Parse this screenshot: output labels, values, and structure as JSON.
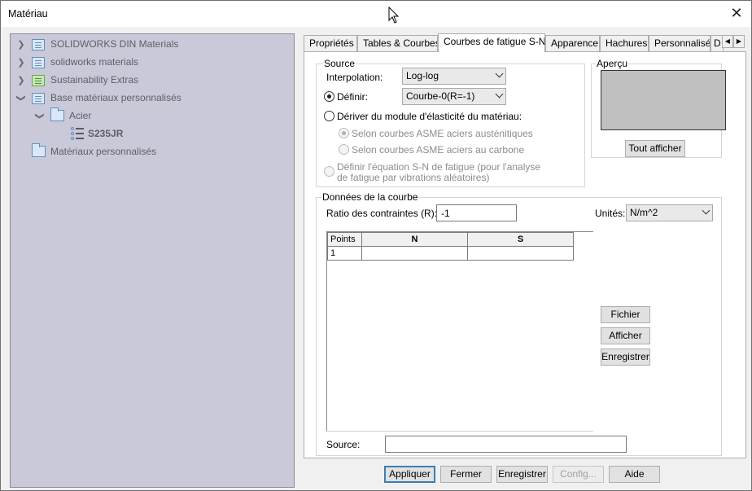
{
  "window": {
    "title": "Matériau",
    "close_glyph": "✕"
  },
  "tree": {
    "items": [
      {
        "label": "SOLIDWORKS DIN Materials",
        "icon": "database-icon"
      },
      {
        "label": "solidworks materials",
        "icon": "database-icon"
      },
      {
        "label": "Sustainability Extras",
        "icon": "database-green-icon"
      },
      {
        "label": "Base matériaux personnalisés",
        "icon": "database-icon"
      },
      {
        "label": "Acier",
        "icon": "folder-icon"
      },
      {
        "label": "S235JR",
        "icon": "material-icon"
      },
      {
        "label": "Matériaux personnalisés",
        "icon": "folder-icon"
      }
    ]
  },
  "tabs": [
    "Propriétés",
    "Tables & Courbes",
    "Courbes de fatigue S-N",
    "Apparence",
    "Hachures",
    "Personnalisé",
    "D"
  ],
  "source": {
    "legend": "Source",
    "interpolation_label": "Interpolation:",
    "interpolation_value": "Log-log",
    "definir_label": "Définir:",
    "definir_value": "Courbe-0(R=-1)",
    "deriver_label": "Dériver du module d'élasticité du matériau:",
    "asme_aust": "Selon courbes ASME aciers austénitiques",
    "asme_carb": "Selon courbes ASME aciers au carbone",
    "equation_line1": "Définir l'équation S-N de fatigue (pour l'analyse",
    "equation_line2": "de fatigue par vibrations aléatoires)"
  },
  "apercu": {
    "legend": "Aperçu",
    "button": "Tout afficher"
  },
  "curve": {
    "legend": "Données de la courbe",
    "ratio_label": "Ratio des contraintes (R):",
    "ratio_value": "-1",
    "units_label": "Unités:",
    "units_value": "N/m^2",
    "columns": [
      "Points",
      "N",
      "S"
    ],
    "rows": [
      [
        "1",
        "",
        ""
      ]
    ],
    "buttons": {
      "file": "Fichier",
      "show": "Afficher",
      "save": "Enregistrer"
    },
    "source_label": "Source:",
    "source_value": ""
  },
  "footer": {
    "apply": "Appliquer",
    "close": "Fermer",
    "save": "Enregistrer",
    "config": "Config...",
    "help": "Aide"
  }
}
